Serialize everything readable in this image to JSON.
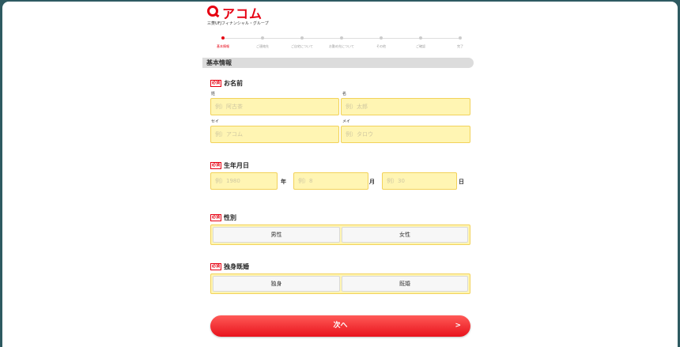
{
  "brand": {
    "name": "アコム",
    "tagline": "三菱UFJフィナンシャル・グループ",
    "color": "#e60012"
  },
  "steps": [
    {
      "label": "基本情報",
      "active": true
    },
    {
      "label": "ご連絡先",
      "active": false
    },
    {
      "label": "ご自宅について",
      "active": false
    },
    {
      "label": "お勤め先について",
      "active": false
    },
    {
      "label": "その他",
      "active": false
    },
    {
      "label": "ご確認",
      "active": false
    },
    {
      "label": "完了",
      "active": false
    }
  ],
  "section_title": "基本情報",
  "required_badge": "必須",
  "name": {
    "title": "お名前",
    "sei_label": "姓",
    "mei_label": "名",
    "sei_placeholder": "例）阿古茶",
    "mei_placeholder": "例）太郎",
    "sei_kana_label": "セイ",
    "mei_kana_label": "メイ",
    "sei_kana_placeholder": "例）アコム",
    "mei_kana_placeholder": "例）タロウ"
  },
  "birthdate": {
    "title": "生年月日",
    "year_placeholder": "例）1980",
    "year_unit": "年",
    "month_placeholder": "例）8",
    "month_unit": "月",
    "day_placeholder": "例）30",
    "day_unit": "日"
  },
  "gender": {
    "title": "性別",
    "options": [
      "男性",
      "女性"
    ]
  },
  "marital": {
    "title": "独身既婚",
    "options": [
      "独身",
      "既婚"
    ]
  },
  "next_button": {
    "label": "次へ",
    "arrow": ">"
  }
}
